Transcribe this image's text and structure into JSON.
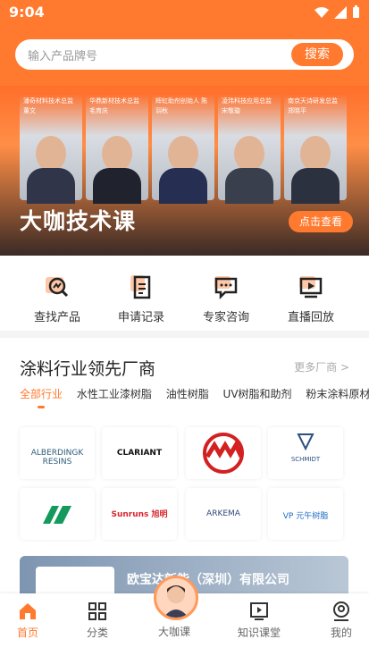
{
  "status_bar": {
    "time": "9:04"
  },
  "search": {
    "placeholder": "输入产品牌号",
    "button": "搜索"
  },
  "banner": {
    "title": "大咖技术课",
    "cta": "点击查看",
    "speakers": [
      {
        "caption": "潘奇材料技术总监 董文"
      },
      {
        "caption": "华鼎新材技术总监 毛育庆"
      },
      {
        "caption": "辉虹助剂创始人 陈羽秋"
      },
      {
        "caption": "凌玮科技应用总监 宋敬璇"
      },
      {
        "caption": "南京天诗研发总监 郑晓平"
      }
    ]
  },
  "quick_actions": [
    {
      "label": "查找产品",
      "icon": "chart-search-icon"
    },
    {
      "label": "申请记录",
      "icon": "document-icon"
    },
    {
      "label": "专家咨询",
      "icon": "chat-icon"
    },
    {
      "label": "直播回放",
      "icon": "play-icon"
    }
  ],
  "vendors": {
    "title": "涂料行业领先厂商",
    "more": "更多厂商 >",
    "tabs": [
      "全部行业",
      "水性工业漆树脂",
      "油性树脂",
      "UV树脂和助剂",
      "粉末涂料原材"
    ],
    "logos": [
      {
        "name": "ALBERDINGK RESINS",
        "color": "#2f5d7a"
      },
      {
        "name": "CLARIANT",
        "color": "#111111"
      },
      {
        "name": "ΛΛΛ",
        "color": "#d32020"
      },
      {
        "name": "SCHMIDT",
        "color": "#2d4f83"
      },
      {
        "name": "▲▲",
        "color": "#149a5c"
      },
      {
        "name": "Sunruns 旭明",
        "color": "#d9262e"
      },
      {
        "name": "ARKEMA",
        "color": "#2e4a7a"
      },
      {
        "name": "VP 元午树脂",
        "color": "#1e6bc4"
      }
    ]
  },
  "promo": {
    "title": "欧宝达新能（深圳）有限公司"
  },
  "tabbar": [
    {
      "label": "首页",
      "icon": "home-icon"
    },
    {
      "label": "分类",
      "icon": "grid-icon"
    },
    {
      "label": "大咖课",
      "icon": "avatar"
    },
    {
      "label": "知识课堂",
      "icon": "video-icon"
    },
    {
      "label": "我的",
      "icon": "user-icon"
    }
  ],
  "colors": {
    "accent": "#ff7a2f",
    "text": "#333333"
  }
}
